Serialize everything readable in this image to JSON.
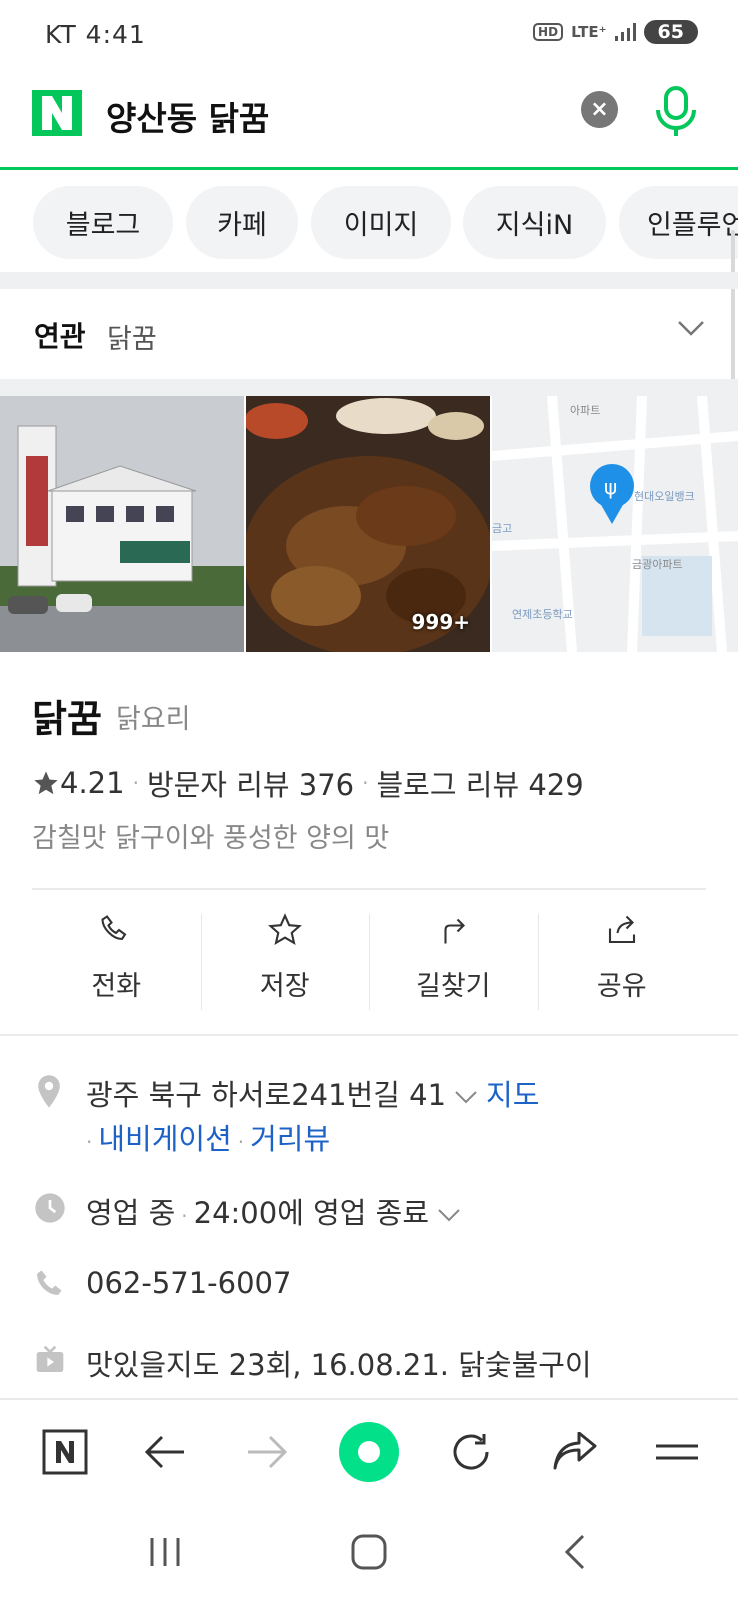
{
  "status_bar": {
    "carrier_time": "KT 4:41",
    "hd": "HD",
    "lte": "LTE⁺",
    "battery": "65"
  },
  "search": {
    "query": "양산동 닭꿈",
    "logo_letter": "N",
    "brand_color": "#03c75a",
    "clear_icon": "close-icon",
    "mic_icon": "mic-icon"
  },
  "tabs": [
    "블로그",
    "카페",
    "이미지",
    "지식iN",
    "인플루언"
  ],
  "related": {
    "label": "연관",
    "term": "닭꿈"
  },
  "photos": {
    "count_badge": "999+",
    "map_labels": [
      "아파트",
      "현대오일뱅크",
      "금광아파트",
      "연제초등학교",
      "금고"
    ]
  },
  "place": {
    "name": "닭꿈",
    "category": "닭요리",
    "rating": "4.21",
    "visitor_reviews": "방문자 리뷰 376",
    "blog_reviews": "블로그 리뷰 429",
    "description": "감칠맛 닭구이와 풍성한 양의 맛"
  },
  "actions": [
    {
      "label": "전화",
      "icon": "phone-icon"
    },
    {
      "label": "저장",
      "icon": "star-icon"
    },
    {
      "label": "길찾기",
      "icon": "directions-icon"
    },
    {
      "label": "공유",
      "icon": "share-icon"
    }
  ],
  "info": {
    "address": "광주 북구 하서로241번길 41",
    "map_link": "지도",
    "navigation_link": "내비게이션",
    "street_view_link": "거리뷰",
    "hours": "영업 중",
    "closing": "24:00에 영업 종료",
    "phone": "062-571-6007",
    "tv": "맛있을지도 23회, 16.08.21. 닭숯불구이"
  },
  "colors": {
    "link": "#1d63c7",
    "accent": "#03c75a"
  }
}
